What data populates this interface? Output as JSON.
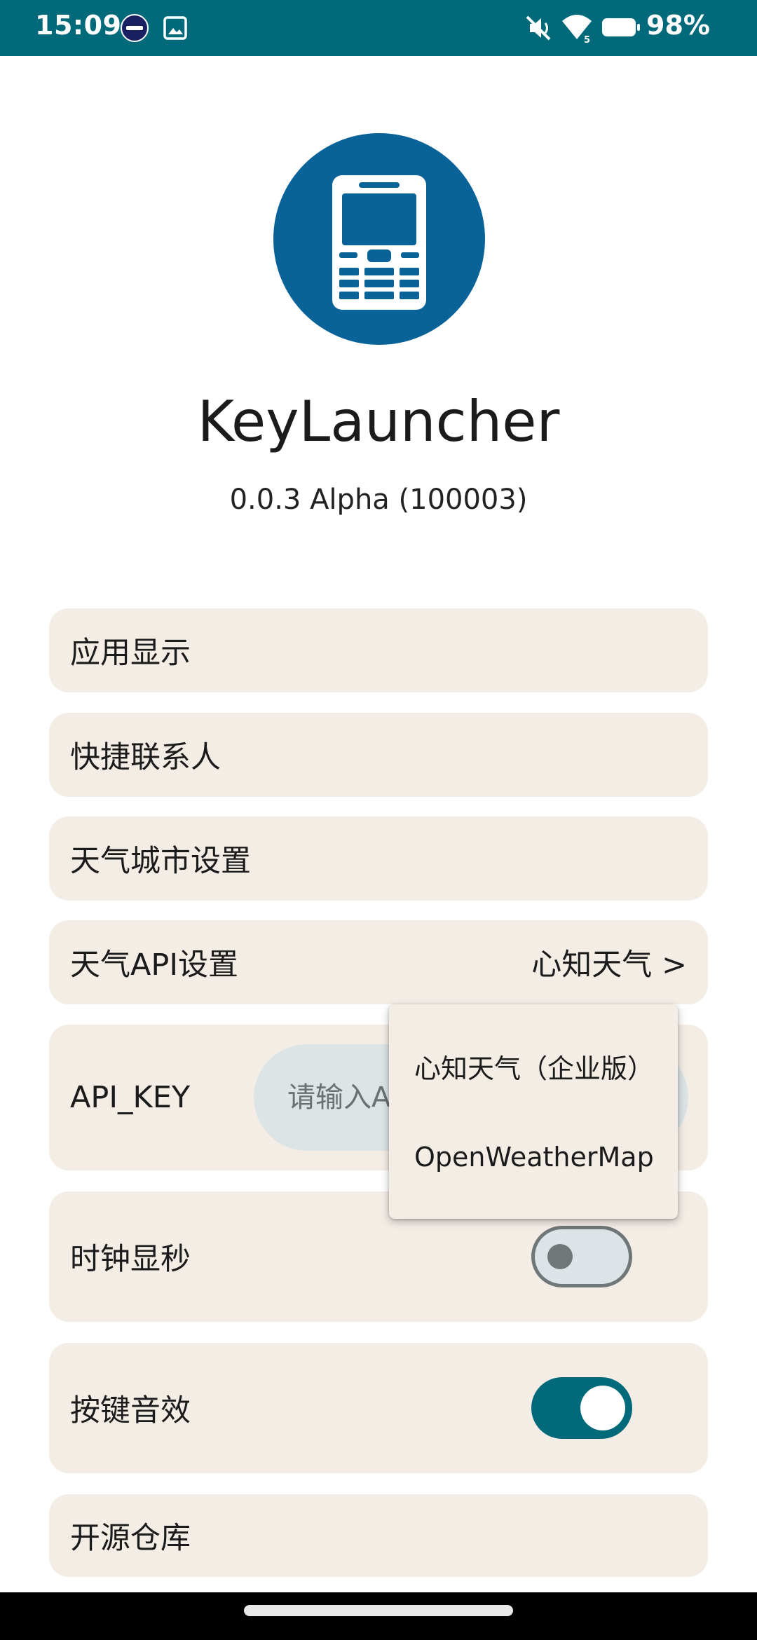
{
  "status_bar": {
    "time": "15:09",
    "battery": "98%",
    "icons": [
      "notification-app-icon",
      "gallery-icon",
      "mute-icon",
      "wifi-icon",
      "battery-icon"
    ],
    "background_color": "#006a7a"
  },
  "app": {
    "name": "KeyLauncher",
    "version": "0.0.3 Alpha (100003)",
    "logo_icon": "feature-phone-icon",
    "logo_color": "#0a6398"
  },
  "settings": {
    "app_display": {
      "label": "应用显示"
    },
    "quick_contacts": {
      "label": "快捷联系人"
    },
    "weather_city": {
      "label": "天气城市设置"
    },
    "weather_api": {
      "label": "天气API设置",
      "value": "心知天气 >"
    },
    "api_key": {
      "label": "API_KEY",
      "placeholder": "请输入API_KEY"
    },
    "clock_seconds": {
      "label": "时钟显秒",
      "enabled": false
    },
    "key_sound": {
      "label": "按键音效",
      "enabled": true
    },
    "open_source": {
      "label": "开源仓库"
    }
  },
  "dropdown": {
    "items": [
      "心知天气（企业版）",
      "OpenWeatherMap"
    ]
  },
  "colors": {
    "card_background": "#f4ede6",
    "accent": "#006a7a",
    "input_background": "#dde4e6"
  }
}
